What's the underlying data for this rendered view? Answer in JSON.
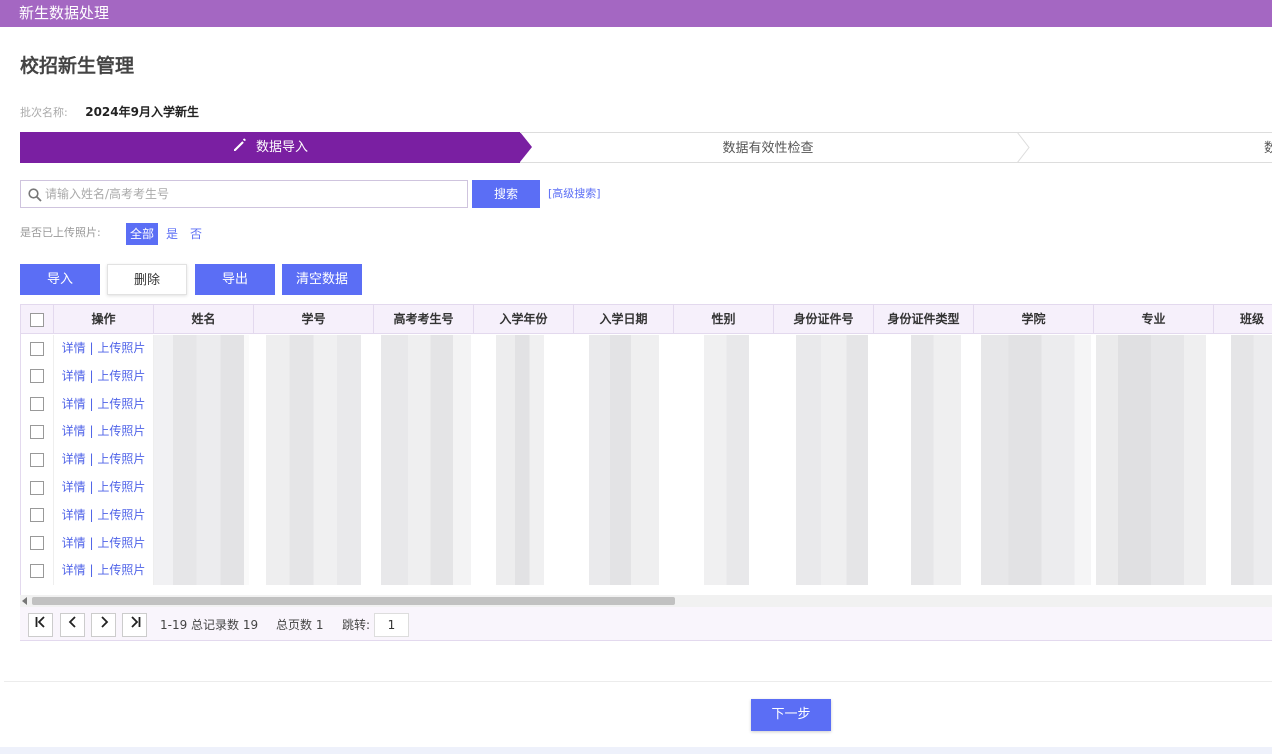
{
  "window": {
    "title": "新生数据处理"
  },
  "page": {
    "title": "校招新生管理"
  },
  "batch": {
    "label": "批次名称:",
    "value": "2024年9月入学新生"
  },
  "steps": [
    {
      "label": "数据导入",
      "state": "active"
    },
    {
      "label": "数据有效性检查",
      "state": "pending"
    },
    {
      "label": "数",
      "state": "pending"
    }
  ],
  "search": {
    "placeholder": "请输入姓名/高考考生号",
    "value": "",
    "button": "搜索",
    "advanced": "[高级搜索]"
  },
  "filter": {
    "label": "是否已上传照片:",
    "options": [
      "全部",
      "是",
      "否"
    ],
    "selected": "全部"
  },
  "actions": {
    "import": "导入",
    "delete": "删除",
    "export": "导出",
    "clear": "清空数据"
  },
  "table": {
    "columns": [
      "操作",
      "姓名",
      "学号",
      "高考考生号",
      "入学年份",
      "入学日期",
      "性别",
      "身份证件号",
      "身份证件类型",
      "学院",
      "专业",
      "班级"
    ],
    "row_actions": {
      "detail": "详情",
      "separator": "|",
      "upload": "上传照片"
    },
    "row_count": 9
  },
  "pager": {
    "first": "K",
    "prev": "<",
    "next": ">",
    "last": ">|",
    "summary": "1-19 总记录数 19",
    "pages": "总页数 1",
    "jump_label": "跳转:",
    "jump_value": "1"
  },
  "footer": {
    "next_step": "下一步"
  },
  "colors": {
    "titlebar": "#a467c2",
    "active_step": "#7a1fa2",
    "primary": "#5b6ef5",
    "link": "#4f63e8"
  }
}
